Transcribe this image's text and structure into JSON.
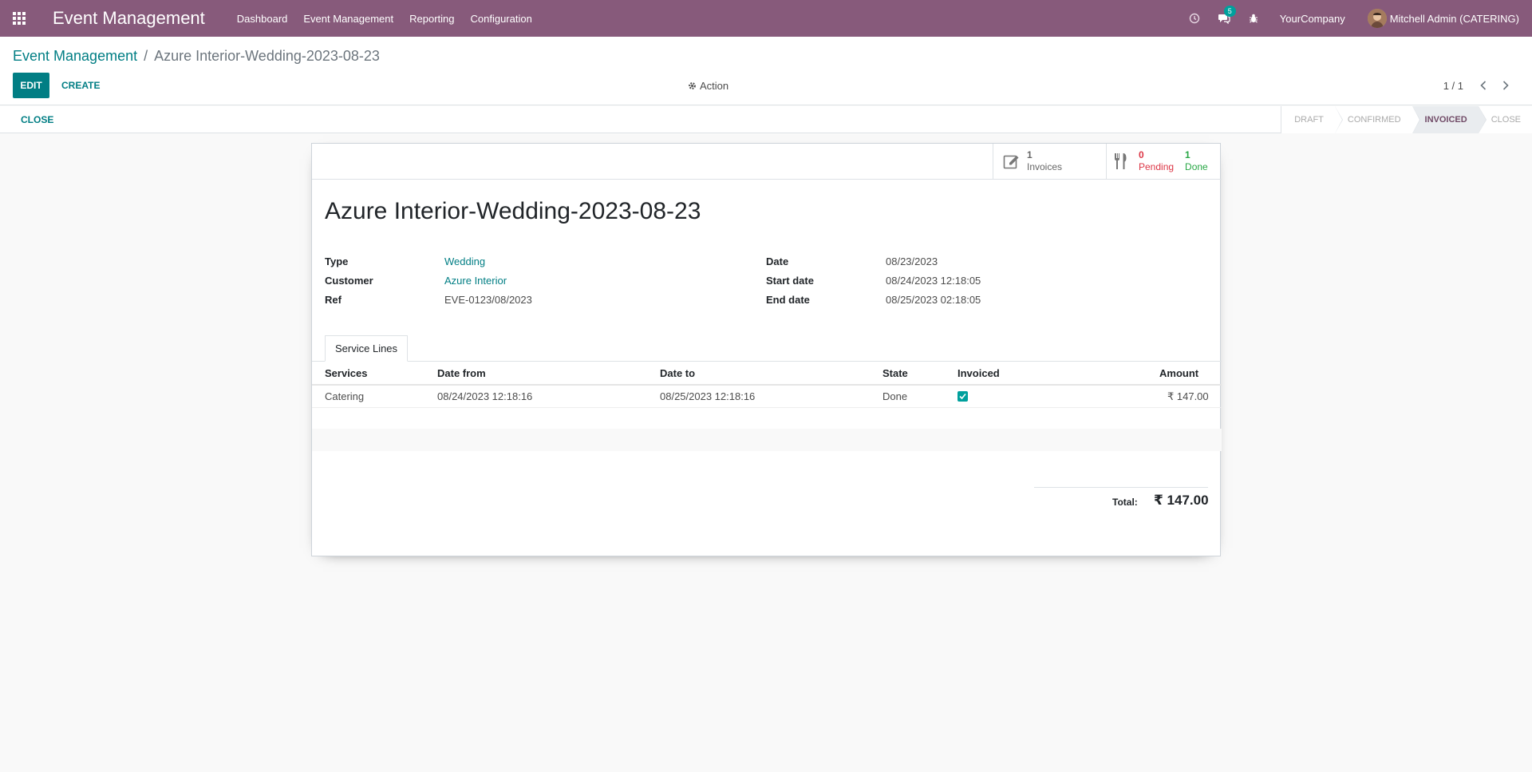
{
  "navbar": {
    "brand": "Event Management",
    "menu": [
      "Dashboard",
      "Event Management",
      "Reporting",
      "Configuration"
    ],
    "messages_badge": "5",
    "company": "YourCompany",
    "user": "Mitchell Admin (CATERING)"
  },
  "control_panel": {
    "breadcrumb_parent": "Event Management",
    "breadcrumb_separator": "/",
    "breadcrumb_current": "Azure Interior-Wedding-2023-08-23",
    "edit_label": "EDIT",
    "create_label": "CREATE",
    "action_label": "Action",
    "pager": "1 / 1"
  },
  "statusbar": {
    "close_label": "CLOSE",
    "stages": [
      "DRAFT",
      "CONFIRMED",
      "INVOICED",
      "CLOSE"
    ],
    "active_stage": "INVOICED"
  },
  "stat_buttons": {
    "invoices_count": "1",
    "invoices_label": "Invoices",
    "pending_count": "0",
    "pending_label": "Pending",
    "done_count": "1",
    "done_label": "Done"
  },
  "form": {
    "title": "Azure Interior-Wedding-2023-08-23",
    "type_label": "Type",
    "type_value": "Wedding",
    "customer_label": "Customer",
    "customer_value": "Azure Interior",
    "ref_label": "Ref",
    "ref_value": "EVE-0123/08/2023",
    "date_label": "Date",
    "date_value": "08/23/2023",
    "start_label": "Start date",
    "start_value": "08/24/2023 12:18:05",
    "end_label": "End date",
    "end_value": "08/25/2023 02:18:05"
  },
  "tabs": {
    "service_lines": "Service Lines"
  },
  "table": {
    "columns": [
      "Services",
      "Date from",
      "Date to",
      "State",
      "Invoiced",
      "Amount"
    ],
    "rows": [
      {
        "service": "Catering",
        "date_from": "08/24/2023 12:18:16",
        "date_to": "08/25/2023 12:18:16",
        "state": "Done",
        "invoiced": true,
        "amount": "₹ 147.00"
      }
    ]
  },
  "total": {
    "label": "Total:",
    "value": "₹ 147.00"
  },
  "colors": {
    "navbar": "#875a7b",
    "primary": "#017e84",
    "checkbox": "#00a09d"
  }
}
